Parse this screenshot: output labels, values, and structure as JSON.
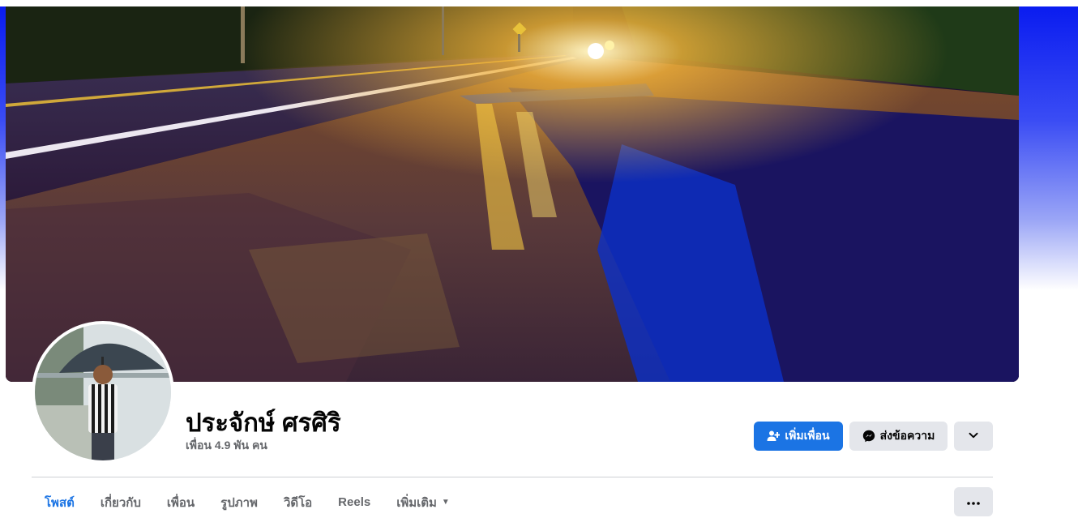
{
  "profile": {
    "name": "ประจักษ์ ศรศิริ",
    "friends_label": "เพื่อน",
    "friends_count": "4.9 พัน",
    "friends_unit": "คน"
  },
  "actions": {
    "add_friend": "เพิ่มเพื่อน",
    "message": "ส่งข้อความ"
  },
  "tabs": [
    {
      "label": "โพสต์",
      "active": true
    },
    {
      "label": "เกี่ยวกับ",
      "active": false
    },
    {
      "label": "เพื่อน",
      "active": false
    },
    {
      "label": "รูปภาพ",
      "active": false
    },
    {
      "label": "วิดีโอ",
      "active": false
    },
    {
      "label": "Reels",
      "active": false
    },
    {
      "label": "เพิ่มเติม",
      "active": false
    }
  ],
  "icons": {
    "add_friend": "add-person-icon",
    "message": "messenger-icon",
    "more": "chevron-down-icon",
    "overflow": "ellipsis-icon"
  },
  "colors": {
    "primary": "#1b74e4",
    "secondary_button": "#e4e6eb",
    "muted_text": "#65676b",
    "text": "#050505"
  }
}
